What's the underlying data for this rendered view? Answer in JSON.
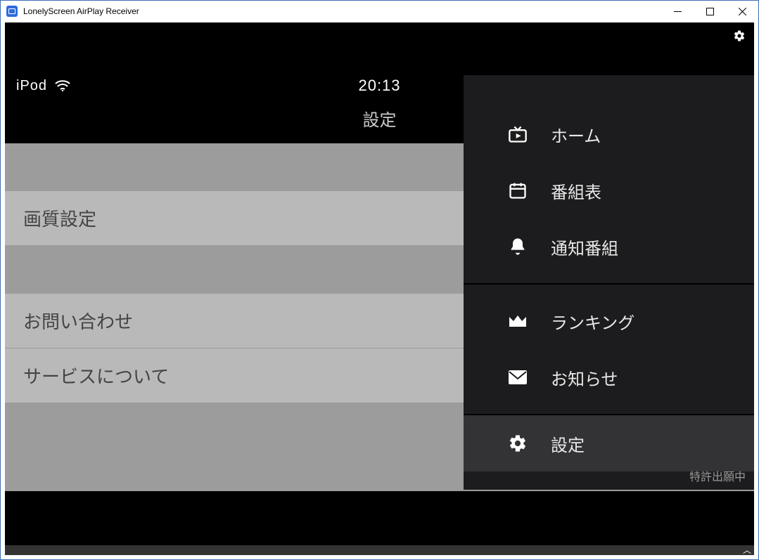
{
  "window": {
    "title": "LonelyScreen AirPlay Receiver"
  },
  "statusbar": {
    "device": "iPod",
    "time": "20:13"
  },
  "page": {
    "title": "設定"
  },
  "settings": {
    "rows": [
      {
        "label": "画質設定"
      },
      {
        "label": "お問い合わせ"
      },
      {
        "label": "サービスについて"
      }
    ]
  },
  "menu": {
    "items": [
      {
        "label": "ホーム",
        "icon": "tv"
      },
      {
        "label": "番組表",
        "icon": "calendar"
      },
      {
        "label": "通知番組",
        "icon": "bell"
      },
      {
        "label": "ランキング",
        "icon": "crown"
      },
      {
        "label": "お知らせ",
        "icon": "mail"
      },
      {
        "label": "設定",
        "icon": "gear",
        "active": true
      }
    ],
    "patent": "特許出願中"
  }
}
